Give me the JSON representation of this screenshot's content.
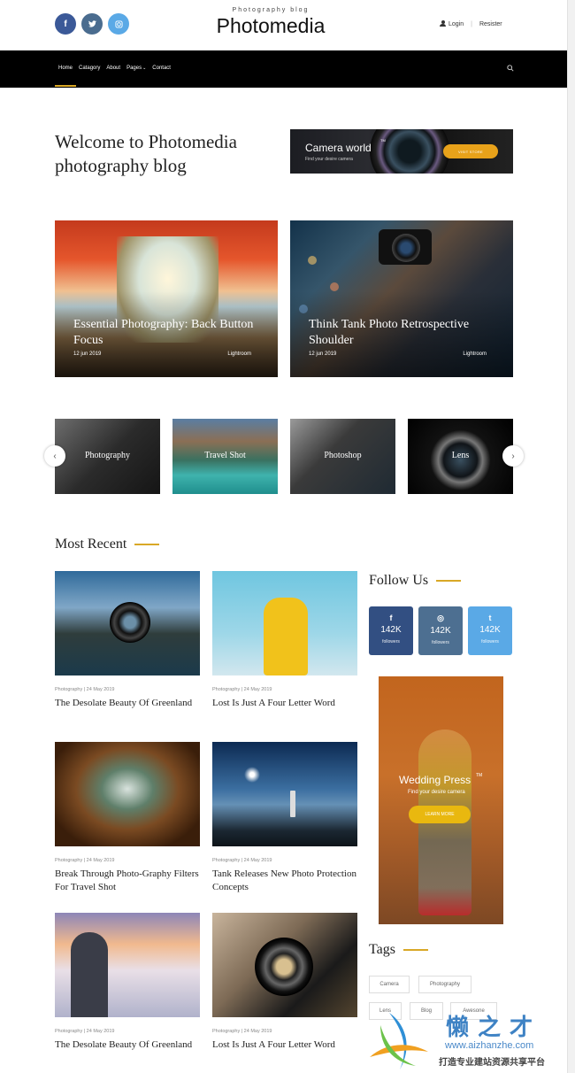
{
  "header": {
    "tagline": "Photography blog",
    "brand": "Photomedia",
    "login": "Login",
    "register": "Resister",
    "socials": [
      "facebook-icon",
      "twitter-icon",
      "instagram-icon"
    ]
  },
  "nav": {
    "items": [
      "Home",
      "Catagory",
      "About",
      "Pages",
      "Contact"
    ],
    "active": "Home"
  },
  "hero": {
    "welcome": "Welcome to Photomedia photography blog",
    "banner": {
      "title": "Camera world",
      "tm": "TM",
      "subtitle": "Find your desire camera",
      "button": "VISIT STORE"
    }
  },
  "featured": [
    {
      "title": "Essential Photography: Back Button Focus",
      "date": "12 jun 2019",
      "category": "Lightroom"
    },
    {
      "title": "Think Tank Photo Retrospective Shoulder",
      "date": "12 jun 2019",
      "category": "Lightroom"
    }
  ],
  "categories": [
    "Photography",
    "Travel Shot",
    "Photoshop",
    "Lens"
  ],
  "most_recent": {
    "heading": "Most Recent",
    "posts": [
      {
        "meta": "Photography | 24 May 2019",
        "title": "The Desolate Beauty Of Greenland"
      },
      {
        "meta": "Photography | 24 May 2019",
        "title": "Lost Is Just A Four Letter Word"
      },
      {
        "meta": "Photography | 24 May 2019",
        "title": "Break Through Photo-Graphy Filters For Travel Shot"
      },
      {
        "meta": "Photography | 24 May 2019",
        "title": "Tank Releases New Photo Protection Concepts"
      },
      {
        "meta": "Photography | 24 May 2019",
        "title": "The Desolate Beauty Of Greenland"
      },
      {
        "meta": "Photography | 24 May 2019",
        "title": "Lost Is Just A Four Letter Word"
      }
    ]
  },
  "sidebar": {
    "follow_heading": "Follow Us",
    "follow": [
      {
        "icon": "facebook-icon",
        "glyph": "f",
        "count": "142K",
        "label": "followers"
      },
      {
        "icon": "instagram-icon",
        "glyph": "◎",
        "count": "142K",
        "label": "followers"
      },
      {
        "icon": "twitter-icon",
        "glyph": "t",
        "count": "142K",
        "label": "followers"
      }
    ],
    "ad": {
      "title": "Wedding Press",
      "tm": "TM",
      "subtitle": "Find your desire camera",
      "button": "LEARN MORE"
    },
    "tags_heading": "Tags",
    "tags": [
      "Camera",
      "Photography",
      "Lens",
      "Blog",
      "Awesone"
    ]
  },
  "watermark": {
    "brand": "懒之才",
    "url": "www.aizhanzhe.com",
    "slogan": "打造专业建站资源共享平台"
  },
  "colors": {
    "accent": "#d9a826",
    "nav_bg": "#000000",
    "facebook": "#324f82",
    "instagram": "#4d6f91",
    "twitter": "#5aa9e6"
  }
}
